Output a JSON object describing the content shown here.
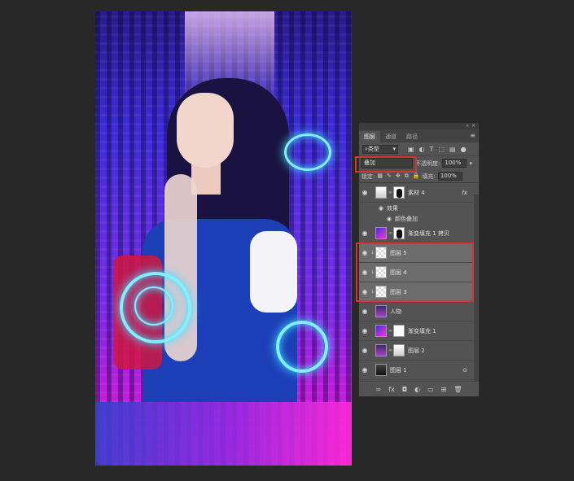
{
  "panel": {
    "tabs": [
      "图层",
      "通道",
      "路径"
    ],
    "active_tab": 0,
    "filter_kind": "类型",
    "blend_mode": "叠加",
    "opacity_label": "不透明度:",
    "opacity_value": "100%",
    "lock_label": "锁定:",
    "fill_label": "填充:",
    "fill_value": "100%",
    "layers": [
      {
        "name": "素材 4",
        "thumb": "photo",
        "mask": true,
        "fx": "fx",
        "selected": false,
        "clip": false
      },
      {
        "name": "效果",
        "type": "effects-header"
      },
      {
        "name": "颜色叠加",
        "type": "effect"
      },
      {
        "name": "渐变填充 1 拷贝",
        "thumb": "grad",
        "mask": true,
        "selected": false,
        "clip": false
      },
      {
        "name": "图层 5",
        "thumb": "check",
        "selected": true,
        "clip": true
      },
      {
        "name": "图层 4",
        "thumb": "check",
        "selected": true,
        "clip": true
      },
      {
        "name": "图层 3",
        "thumb": "check",
        "selected": true,
        "clip": true
      },
      {
        "name": "人物",
        "thumb": "photo",
        "selected": false,
        "clip": false
      },
      {
        "name": "渐变填充 1",
        "thumb": "grad",
        "mask": true,
        "selected": false,
        "clip": false
      },
      {
        "name": "图层 2",
        "thumb": "photo",
        "mask": true,
        "selected": false,
        "clip": false
      },
      {
        "name": "图层 1",
        "thumb": "dark",
        "selected": false,
        "clip": false
      }
    ],
    "colors": {
      "panel_bg": "#535353",
      "highlight_box": "#d43434",
      "selected_row": "#6c6c6c"
    }
  }
}
